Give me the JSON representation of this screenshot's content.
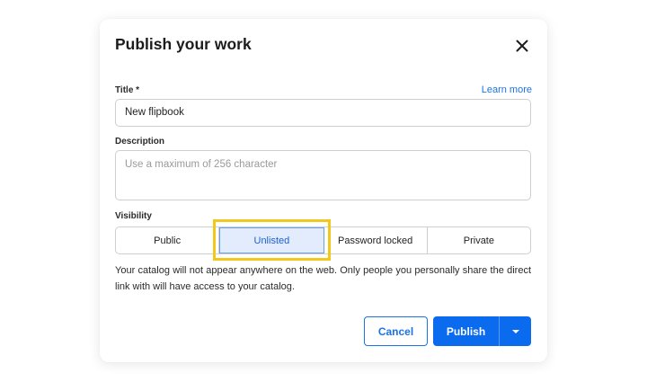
{
  "dialog": {
    "title": "Publish your work",
    "close_icon": "close-icon"
  },
  "title_field": {
    "label": "Title *",
    "value": "New flipbook",
    "learn_more": "Learn more"
  },
  "description_field": {
    "label": "Description",
    "placeholder": "Use a maximum of 256 character"
  },
  "visibility": {
    "label": "Visibility",
    "options": [
      "Public",
      "Unlisted",
      "Password locked",
      "Private"
    ],
    "selected": "Unlisted",
    "help_text": "Your catalog will not appear anywhere on the web. Only people you personally share the direct link with will have access to your catalog."
  },
  "actions": {
    "cancel": "Cancel",
    "publish": "Publish",
    "dropdown_icon": "caret-down-icon"
  },
  "colors": {
    "accent": "#0b6bef",
    "link": "#1a73e8",
    "highlight": "#f2c81d",
    "selected_bg": "#e2ecfd"
  }
}
